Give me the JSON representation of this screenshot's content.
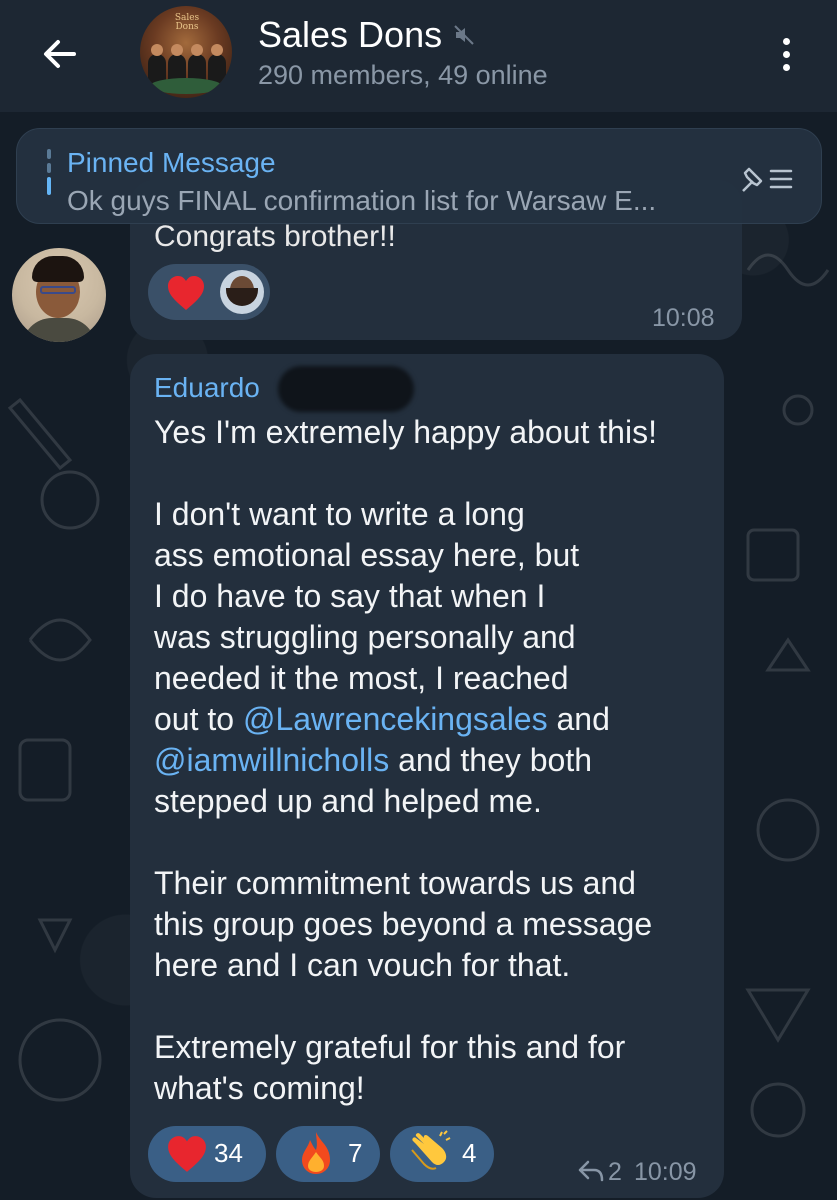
{
  "header": {
    "title": "Sales Dons",
    "subtitle": "290 members, 49 online",
    "avatar_logo": "Sales Dons"
  },
  "pinned": {
    "title": "Pinned Message",
    "text": "Ok guys FINAL confirmation list for Warsaw E..."
  },
  "message_prev": {
    "partial_text": "Congrats brother!!",
    "reaction": "heart",
    "time": "10:08"
  },
  "message": {
    "sender": "Eduardo",
    "lines": [
      "Yes I'm extremely happy about this!",
      "",
      "I don't want to write a long",
      "ass emotional essay here, but",
      "I do have to say that when I",
      "was struggling personally and",
      "needed it the most, I reached",
      "out to",
      "and they both",
      "stepped up and helped me.",
      "",
      "Their commitment towards us and",
      "this group goes beyond a message",
      "here and I can vouch for that.",
      "",
      "Extremely grateful for this and for",
      "what's coming!"
    ],
    "mention1": "@Lawrencekingsales",
    "mention1_after": " and",
    "mention2": "@iamwillnicholls",
    "reactions": [
      {
        "icon": "heart-icon",
        "count": "34"
      },
      {
        "icon": "fire-icon",
        "count": "7"
      },
      {
        "icon": "clap-icon",
        "count": "4"
      }
    ],
    "replies": "2",
    "time": "10:09"
  },
  "colors": {
    "accent": "#6ab3f3",
    "bubble": "#232f3d",
    "header": "#1d2733",
    "reaction_pill": "#3a5f86"
  }
}
